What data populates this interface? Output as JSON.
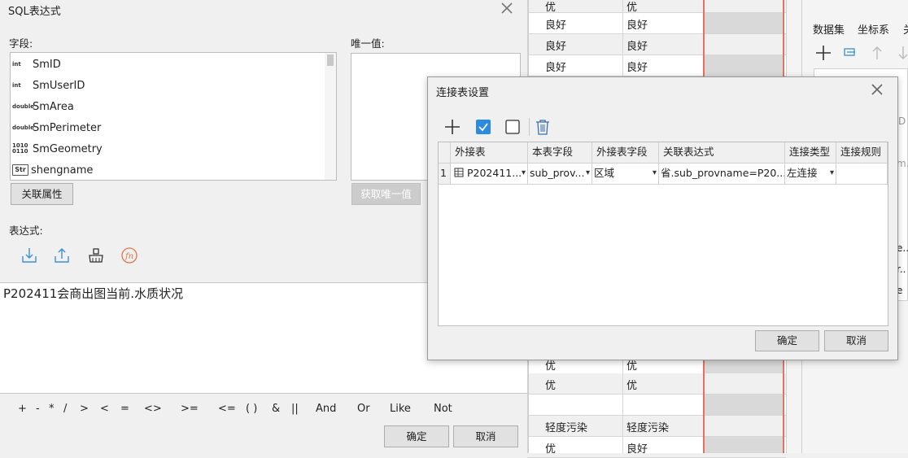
{
  "sql_dialog": {
    "title": "SQL表达式",
    "fields_label": "字段:",
    "unique_label": "唯一值:",
    "fields": [
      {
        "type": "int",
        "name": "SmID"
      },
      {
        "type": "int",
        "name": "SmUserID"
      },
      {
        "type": "double",
        "name": "SmArea"
      },
      {
        "type": "double",
        "name": "SmPerimeter"
      },
      {
        "type": "binary",
        "name": "SmGeometry"
      },
      {
        "type": "Str",
        "name": "shengname"
      }
    ],
    "related_button": "关联属性",
    "get_unique_button": "获取唯一值",
    "expression_label": "表达式:",
    "expression_value": "P202411会商出图当前.水质状况",
    "operators": [
      "+",
      "-",
      "*",
      "/",
      ">",
      "<",
      "=",
      "<>",
      ">=",
      "<=",
      "( )",
      "&",
      "||",
      "And",
      "Or",
      "Like",
      "Not"
    ],
    "ok_button": "确定",
    "cancel_button": "取消"
  },
  "background_table": {
    "rows": [
      {
        "a": "优",
        "b": "优"
      },
      {
        "a": "良好",
        "b": "良好"
      },
      {
        "a": "良好",
        "b": "良好"
      },
      {
        "a": "良好",
        "b": "良好"
      },
      {
        "a": "优",
        "b": "优"
      },
      {
        "a": "优",
        "b": "优"
      },
      {
        "a": "",
        "b": ""
      },
      {
        "a": "轻度污染",
        "b": "轻度污染"
      },
      {
        "a": "优",
        "b": "良好"
      }
    ]
  },
  "right_panel": {
    "tabs": [
      "数据集",
      "坐标系",
      "关"
    ],
    "fragments": [
      "D",
      "m.",
      "e..",
      "r..",
      "e"
    ]
  },
  "join_dialog": {
    "title": "连接表设置",
    "columns": [
      "外接表",
      "本表字段",
      "外接表字段",
      "关联表达式",
      "连接类型",
      "连接规则"
    ],
    "rows": [
      {
        "index": "1",
        "external_table": "P202411...",
        "local_field": "sub_prov...",
        "external_field": "区域",
        "expression": "省.sub_provname=P20...",
        "join_type": "左连接",
        "rule": ""
      }
    ],
    "ok_button": "确定",
    "cancel_button": "取消"
  }
}
